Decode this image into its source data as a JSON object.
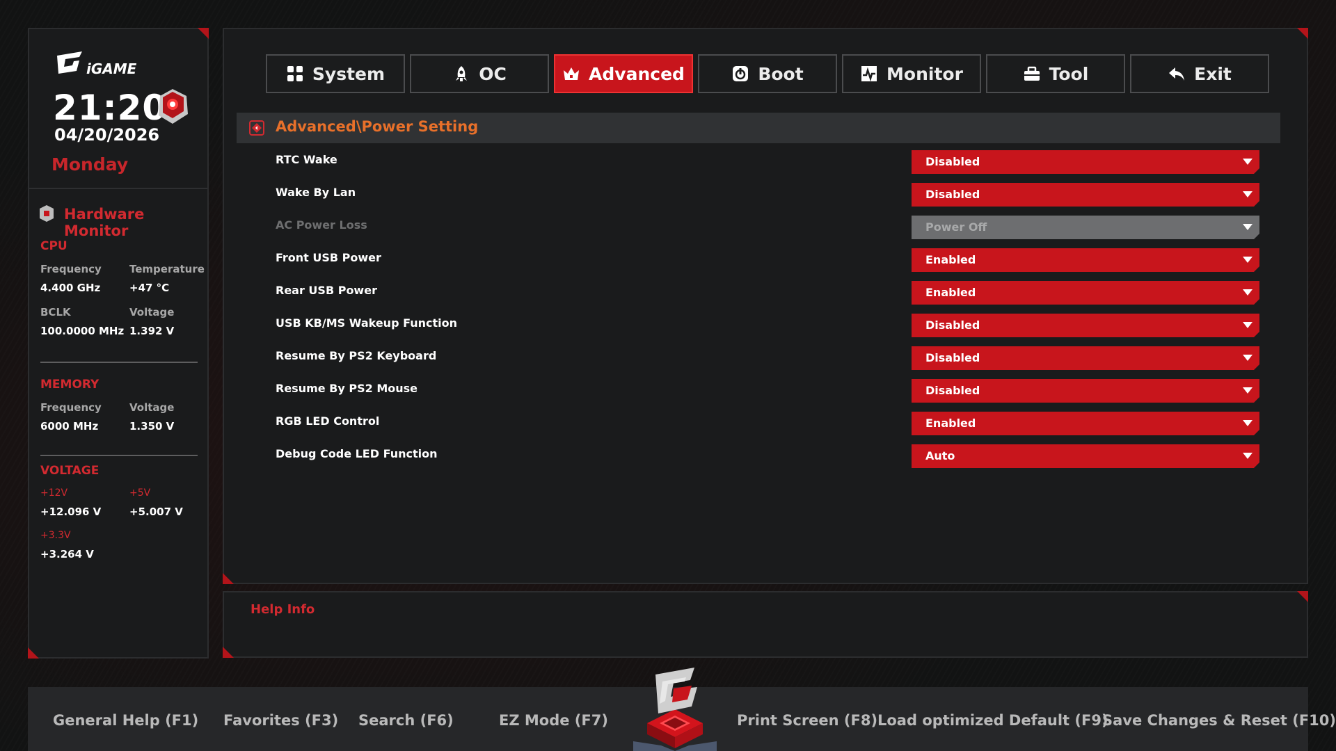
{
  "brand": {
    "logo_text": "iGAME"
  },
  "clock": {
    "time": "21:20",
    "date": "04/20/2026",
    "day": "Monday"
  },
  "hardware_monitor": {
    "title": "Hardware Monitor",
    "cpu": {
      "title": "CPU",
      "frequency_label": "Frequency",
      "frequency": "4.400 GHz",
      "temperature_label": "Temperature",
      "temperature": "+47 °C",
      "bclk_label": "BCLK",
      "bclk": "100.0000 MHz",
      "voltage_label": "Voltage",
      "voltage": "1.392 V"
    },
    "memory": {
      "title": "MEMORY",
      "frequency_label": "Frequency",
      "frequency": "6000 MHz",
      "voltage_label": "Voltage",
      "voltage": "1.350 V"
    },
    "voltage": {
      "title": "VOLTAGE",
      "v12_label": "+12V",
      "v12": "+12.096 V",
      "v5_label": "+5V",
      "v5": "+5.007 V",
      "v33_label": "+3.3V",
      "v33": "+3.264 V"
    }
  },
  "tabs": [
    {
      "label": "System",
      "icon": "grid-icon",
      "active": false
    },
    {
      "label": "OC",
      "icon": "rocket-icon",
      "active": false
    },
    {
      "label": "Advanced",
      "icon": "crown-icon",
      "active": true
    },
    {
      "label": "Boot",
      "icon": "power-icon",
      "active": false
    },
    {
      "label": "Monitor",
      "icon": "pulse-icon",
      "active": false
    },
    {
      "label": "Tool",
      "icon": "toolbox-icon",
      "active": false
    },
    {
      "label": "Exit",
      "icon": "back-arrow-icon",
      "active": false
    }
  ],
  "breadcrumb": "Advanced\\Power Setting",
  "settings": [
    {
      "label": "RTC Wake",
      "value": "Disabled",
      "enabled": true
    },
    {
      "label": "Wake By Lan",
      "value": "Disabled",
      "enabled": true
    },
    {
      "label": "AC Power Loss",
      "value": "Power Off",
      "enabled": false
    },
    {
      "label": "Front USB Power",
      "value": "Enabled",
      "enabled": true
    },
    {
      "label": "Rear USB Power",
      "value": "Enabled",
      "enabled": true
    },
    {
      "label": "USB KB/MS Wakeup Function",
      "value": "Disabled",
      "enabled": true
    },
    {
      "label": "Resume By PS2 Keyboard",
      "value": "Disabled",
      "enabled": true
    },
    {
      "label": "Resume By PS2 Mouse",
      "value": "Disabled",
      "enabled": true
    },
    {
      "label": "RGB LED Control",
      "value": "Enabled",
      "enabled": true
    },
    {
      "label": "Debug Code LED Function",
      "value": "Auto",
      "enabled": true
    }
  ],
  "help": {
    "title": "Help Info"
  },
  "footer": {
    "general_help": "General Help (F1)",
    "favorites": "Favorites (F3)",
    "search": "Search (F6)",
    "ez_mode": "EZ Mode (F7)",
    "print_screen": "Print Screen (F8)",
    "load_defaults": "Load optimized Default (F9)",
    "save_reset": "Save Changes & Reset (F10)"
  },
  "colors": {
    "accent": "#c8151c",
    "breadcrumb": "#e8702a",
    "disabled": "#6d6e70"
  }
}
